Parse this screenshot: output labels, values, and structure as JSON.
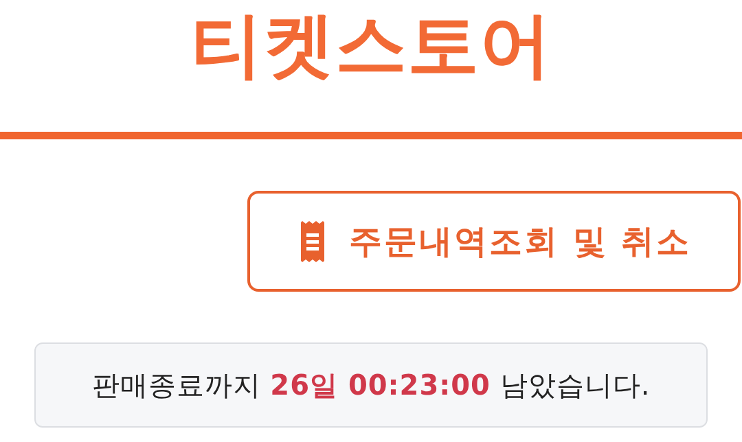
{
  "header": {
    "title": "티켓스토어"
  },
  "order_button": {
    "label": "주문내역조회 및 취소"
  },
  "countdown": {
    "text": "판매종료까지 **26일 00:23:00** 남았습니다."
  }
}
